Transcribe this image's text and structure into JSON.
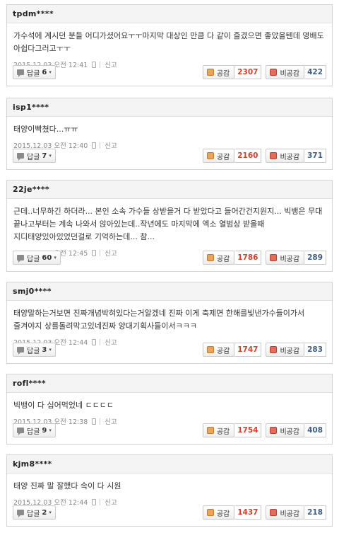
{
  "labels": {
    "reply": "답글",
    "like": "공감",
    "dislike": "비공감",
    "report": "신고",
    "caret": "▾"
  },
  "comments": [
    {
      "username": "tpdm****",
      "text": "가수석에 계시던 분들 어디가셨어요ㅜㅜ마지막 대상인 만큼 다 같이 즐겼으면 좋았을텐데 영배도 아쉽다그러고ㅜㅜ",
      "timestamp": "2015.12.03 오전 12:41",
      "replies": "6",
      "likes": "2307",
      "dislikes": "422"
    },
    {
      "username": "isp1****",
      "text": "태양이빡쳤다...ㅠㅠ",
      "timestamp": "2015.12.03 오전 12:40",
      "replies": "7",
      "likes": "2160",
      "dislikes": "371"
    },
    {
      "username": "22je****",
      "text": "근데..너무하긴 하더라... 본인 소속 가수들 상받을거 다 받았다고 들어간건지원지... 빅뱅은 무대 끝나고부터는 계속 나와서 앉아있는데..작년에도 마지막에 엑소 열범상 받을때 지디태양있아있었던걸로 기억하는데... 참...",
      "timestamp": "2015.12.03 오전 12:45",
      "replies": "60",
      "likes": "1786",
      "dislikes": "289"
    },
    {
      "username": "smj0****",
      "text": "태양말하는거보면 진짜개념박혀있다는거알겠네 진짜 이게 축제면 한해를빛낸가수들이가서 즐겨야지 상를돌려막고있네진짜 양대기획사들이서ㅋㅋㅋ",
      "timestamp": "2015.12.03 오전 12:44",
      "replies": "3",
      "likes": "1747",
      "dislikes": "283"
    },
    {
      "username": "rofl****",
      "text": "빅뱅이 다 십어먹었네 ㄷㄷㄷㄷ",
      "timestamp": "2015.12.03 오전 12:38",
      "replies": "9",
      "likes": "1754",
      "dislikes": "408"
    },
    {
      "username": "kjm8****",
      "text": "태양 진짜 말 잘했다 속이 다 시원",
      "timestamp": "2015.12.03 오전 12:44",
      "replies": "2",
      "likes": "1437",
      "dislikes": "218"
    }
  ]
}
